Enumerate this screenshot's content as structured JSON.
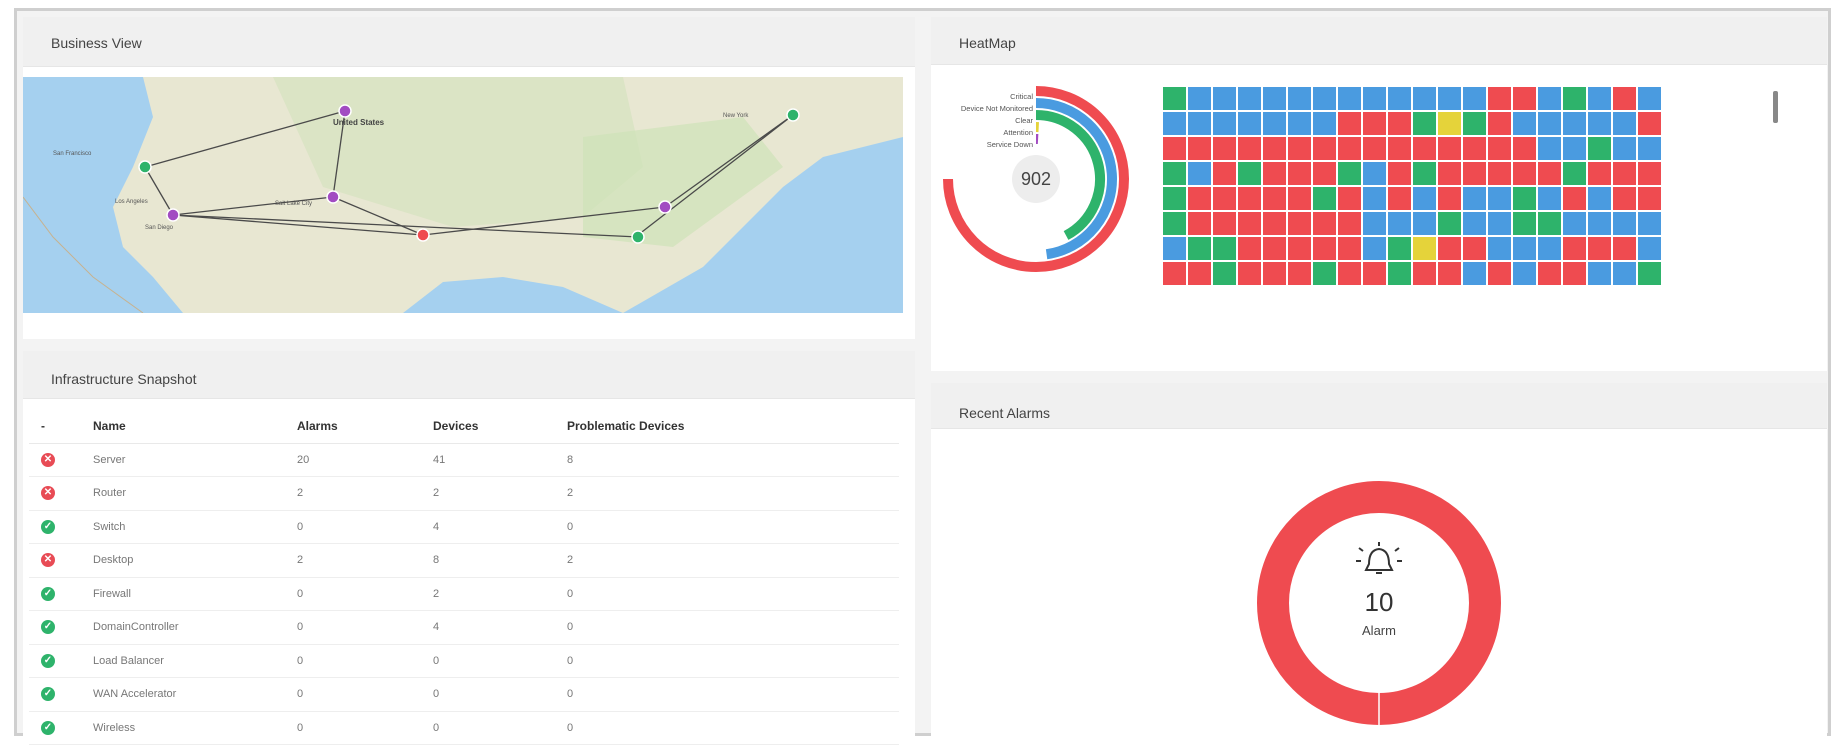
{
  "colors": {
    "critical": "#ef4b50",
    "not_monitored": "#4a9be0",
    "clear": "#2eb36b",
    "attention": "#e5d33a",
    "service_down": "#a24cc2"
  },
  "business_view": {
    "title": "Business View",
    "map_labels": [
      "United States",
      "Los Angeles",
      "San Diego",
      "Salt Lake City",
      "San Francisco",
      "New York"
    ]
  },
  "infra": {
    "title": "Infrastructure Snapshot",
    "columns": [
      "-",
      "Name",
      "Alarms",
      "Devices",
      "Problematic Devices"
    ],
    "rows": [
      {
        "status": "error",
        "name": "Server",
        "alarms": "20",
        "devices": "41",
        "problematic": "8"
      },
      {
        "status": "error",
        "name": "Router",
        "alarms": "2",
        "devices": "2",
        "problematic": "2"
      },
      {
        "status": "ok",
        "name": "Switch",
        "alarms": "0",
        "devices": "4",
        "problematic": "0"
      },
      {
        "status": "error",
        "name": "Desktop",
        "alarms": "2",
        "devices": "8",
        "problematic": "2"
      },
      {
        "status": "ok",
        "name": "Firewall",
        "alarms": "0",
        "devices": "2",
        "problematic": "0"
      },
      {
        "status": "ok",
        "name": "DomainController",
        "alarms": "0",
        "devices": "4",
        "problematic": "0"
      },
      {
        "status": "ok",
        "name": "Load Balancer",
        "alarms": "0",
        "devices": "0",
        "problematic": "0"
      },
      {
        "status": "ok",
        "name": "WAN Accelerator",
        "alarms": "0",
        "devices": "0",
        "problematic": "0"
      },
      {
        "status": "ok",
        "name": "Wireless",
        "alarms": "0",
        "devices": "0",
        "problematic": "0"
      }
    ]
  },
  "heatmap": {
    "title": "HeatMap",
    "total": "902",
    "legend": [
      "Critical",
      "Device Not Monitored",
      "Clear",
      "Attention",
      "Service Down"
    ],
    "grid_rows": [
      "GBBBBBBBBBBBBRRBGBRB",
      "BBBBBBBRRRGYGRBBBBBR",
      "RRRRRRRRRRRRRRRBBGBB",
      "GBRGRRRGBRGRRRRRGRRR",
      "GRRRRRGRBRBRBBGBRBRR",
      "GRRRRRRRBBBGBBGGBBBB",
      "BGGRRRRRBGYRRBBBRRRB",
      "RRGRRRGRRGRRBRBRRBBG"
    ]
  },
  "recent_alarms": {
    "title": "Recent Alarms",
    "count": "10",
    "label": "Alarm"
  }
}
